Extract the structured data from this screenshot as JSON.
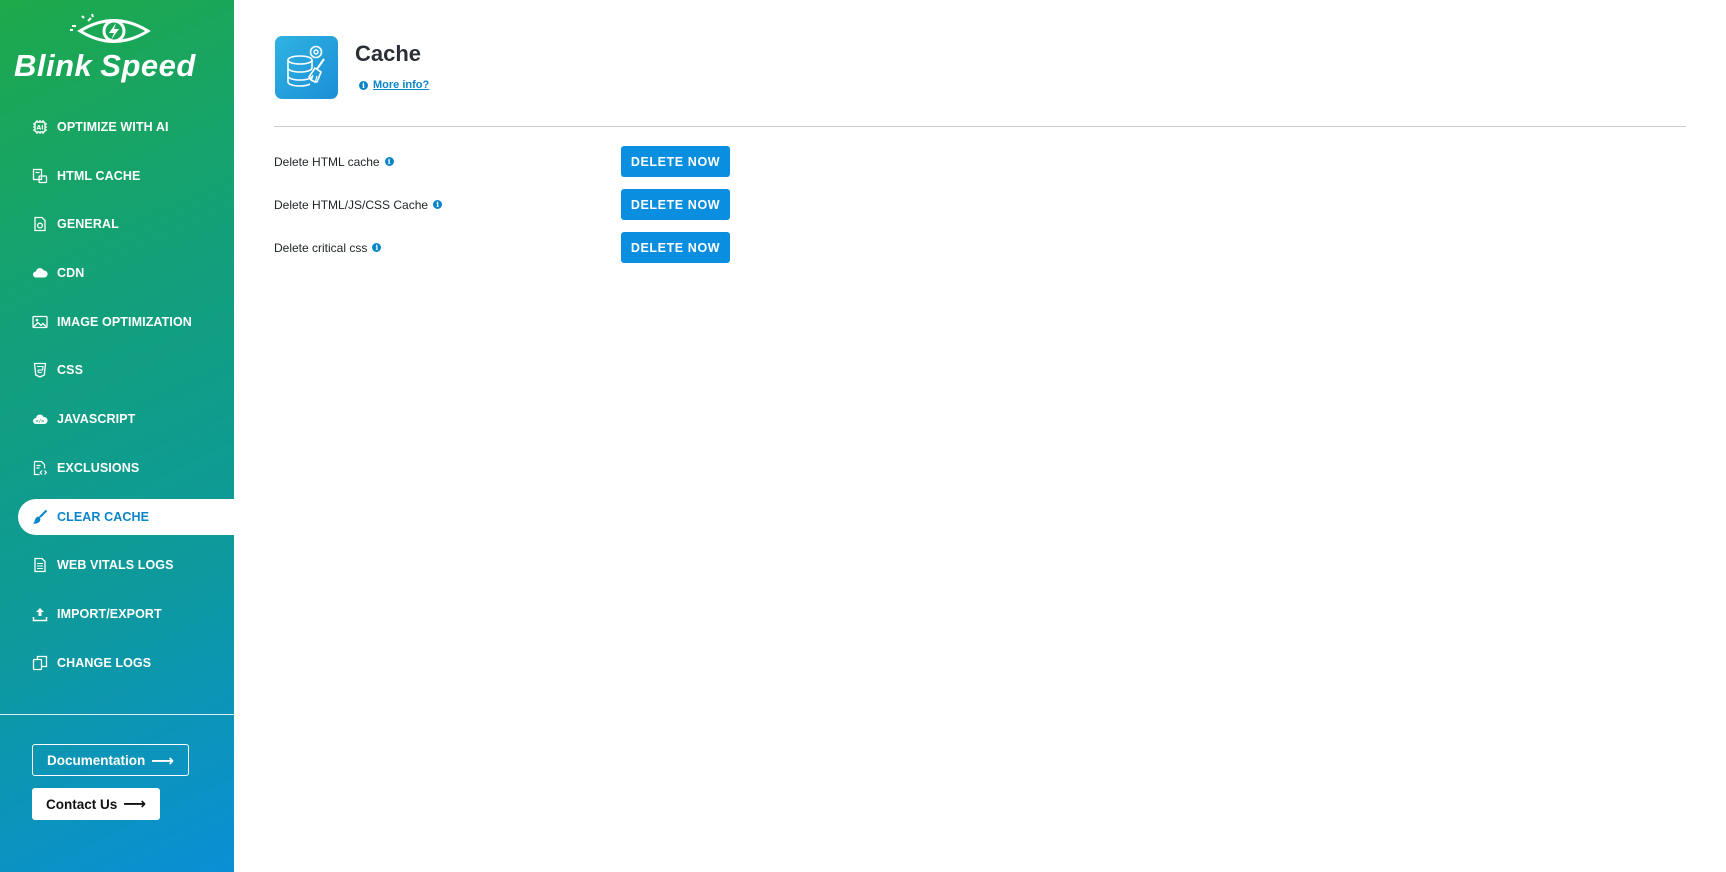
{
  "brand": {
    "part1": "Blink",
    "part2": "Speed"
  },
  "sidebar": {
    "items": [
      {
        "label": "OPTIMIZE WITH AI",
        "icon": "chip-ai-icon"
      },
      {
        "label": "HTML CACHE",
        "icon": "html-cache-icon"
      },
      {
        "label": "GENERAL",
        "icon": "settings-file-icon"
      },
      {
        "label": "CDN",
        "icon": "cloud-icon"
      },
      {
        "label": "IMAGE OPTIMIZATION",
        "icon": "image-icon"
      },
      {
        "label": "CSS",
        "icon": "css3-icon"
      },
      {
        "label": "JAVASCRIPT",
        "icon": "js-cloud-icon"
      },
      {
        "label": "EXCLUSIONS",
        "icon": "code-file-icon"
      },
      {
        "label": "CLEAR CACHE",
        "icon": "brush-icon",
        "active": true
      },
      {
        "label": "WEB VITALS LOGS",
        "icon": "document-icon"
      },
      {
        "label": "IMPORT/EXPORT",
        "icon": "upload-icon"
      },
      {
        "label": "CHANGE LOGS",
        "icon": "copy-icon"
      }
    ],
    "documentation_label": "Documentation",
    "contact_label": "Contact Us"
  },
  "header": {
    "title": "Cache",
    "more_info": "More info?",
    "icon": "database-broom-icon"
  },
  "actions": [
    {
      "label": "Delete HTML cache",
      "button": "DELETE NOW"
    },
    {
      "label": "Delete HTML/JS/CSS Cache",
      "button": "DELETE NOW"
    },
    {
      "label": "Delete critical css",
      "button": "DELETE NOW"
    }
  ],
  "colors": {
    "accent": "#0a8ee0",
    "sidebar_gradient_start": "#1ea94a",
    "sidebar_gradient_end": "#0a8fd6"
  }
}
